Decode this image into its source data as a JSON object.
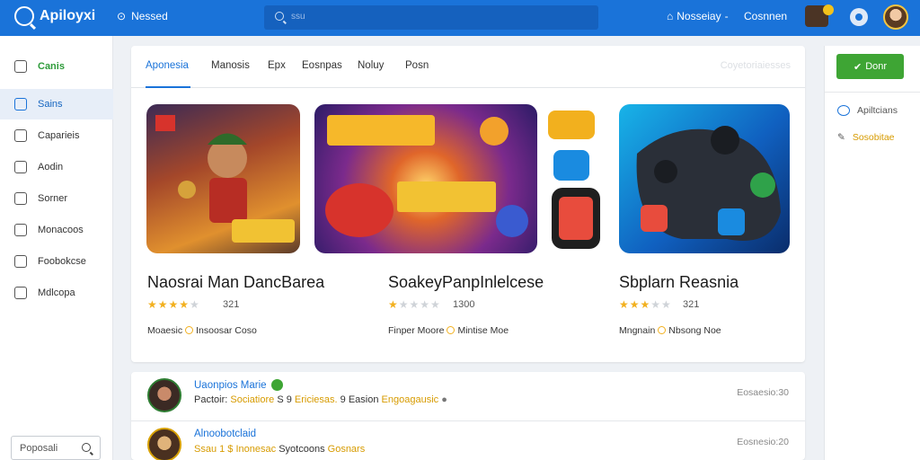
{
  "topbar": {
    "logo": "Apiloyxi",
    "nav_link": "Nessed",
    "search_placeholder": "ssu",
    "home_label": "Nosseiay",
    "user_label": "Cosnnen",
    "accent": "#1a73d9"
  },
  "sidebar": {
    "items": [
      {
        "label": "Canis",
        "icon": "monitor-icon"
      },
      {
        "label": "Sains",
        "icon": "gamepad-icon"
      },
      {
        "label": "Caparieis",
        "icon": "puzzle-icon"
      },
      {
        "label": "Aodin",
        "icon": "person-icon"
      },
      {
        "label": "Sorner",
        "icon": "document-icon"
      },
      {
        "label": "Monacoos",
        "icon": "grid-icon"
      },
      {
        "label": "Foobokcse",
        "icon": "book-icon"
      },
      {
        "label": "Mdlcopa",
        "icon": "user-icon"
      }
    ],
    "search_placeholder": "Poposali"
  },
  "tabs": {
    "items": [
      "Aponesia",
      "Manosis",
      "Epx",
      "Eosnpas",
      "Noluy",
      "Posn"
    ],
    "right": "Coyetoriaiesses"
  },
  "games": [
    {
      "title": "Naosrai Man DancBarea",
      "rating": "321",
      "genre": "Moaesic",
      "price": "Insoosar Coso"
    },
    {
      "title": "SoakeyPanpInlelcese",
      "rating": "1300",
      "genre": "Finper Moore",
      "price": "Mintise Moe"
    },
    {
      "title": "Sbplarn Reasnia",
      "rating": "321",
      "genre": "Mngnain",
      "price": "Nbsong Noe"
    }
  ],
  "right_panel": {
    "button": "Donr",
    "items": [
      {
        "label": "Apiltcians",
        "icon": "headset-icon"
      },
      {
        "label": "Sosobitae",
        "icon": "pencil-icon"
      }
    ]
  },
  "feed": [
    {
      "name": "Uaonpios Marie",
      "verified": true,
      "detail_a": "Pactoir:",
      "detail_hl1": "Sociatiore",
      "detail_b": "S 9",
      "detail_hl2": "Ericiesas.",
      "detail_c": "9 Easion",
      "detail_hl3": "Engoagausic",
      "time": "Eosaesio:30"
    },
    {
      "name": "Alnoobotclaid",
      "verified": false,
      "detail_a": "Ssau 1 $",
      "detail_hl1": "Inonesac",
      "detail_b": "Syotcoons",
      "detail_hl2": "Gosnars",
      "detail_c": "",
      "detail_hl3": "",
      "time": "Eosnesio:20"
    }
  ]
}
